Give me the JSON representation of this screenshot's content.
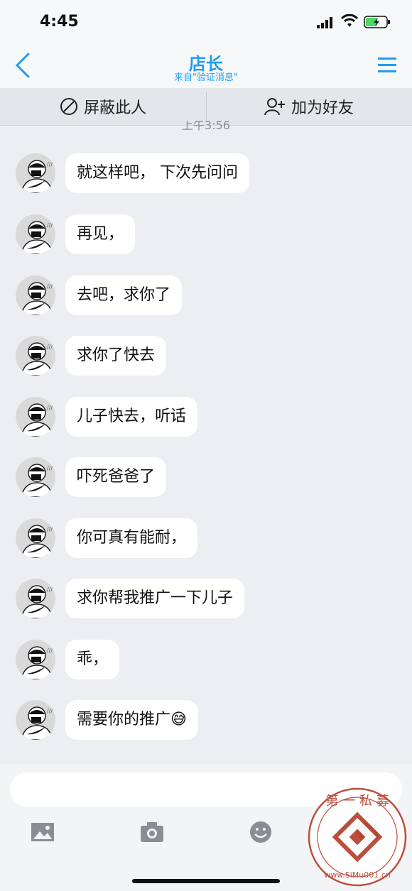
{
  "status": {
    "time": "4:45"
  },
  "header": {
    "title": "店长",
    "subtitle": "来自\"验证消息\""
  },
  "actions": {
    "block_label": "屏蔽此人",
    "add_friend_label": "加为好友"
  },
  "timestamp": "上午3:56",
  "messages": [
    {
      "text": "就这样吧， 下次先问问"
    },
    {
      "text": "再见，"
    },
    {
      "text": "去吧，求你了"
    },
    {
      "text": "求你了快去"
    },
    {
      "text": "儿子快去，听话"
    },
    {
      "text": "吓死爸爸了"
    },
    {
      "text": "你可真有能耐，"
    },
    {
      "text": "求你帮我推广一下儿子"
    },
    {
      "text": "乖，"
    },
    {
      "text": "需要你的推广😅"
    }
  ],
  "watermark": {
    "text": "第一私募",
    "url": "www.SiMu001.cn"
  },
  "colors": {
    "accent": "#1f9df0",
    "background": "#edeef2",
    "bubble": "#ffffff"
  }
}
